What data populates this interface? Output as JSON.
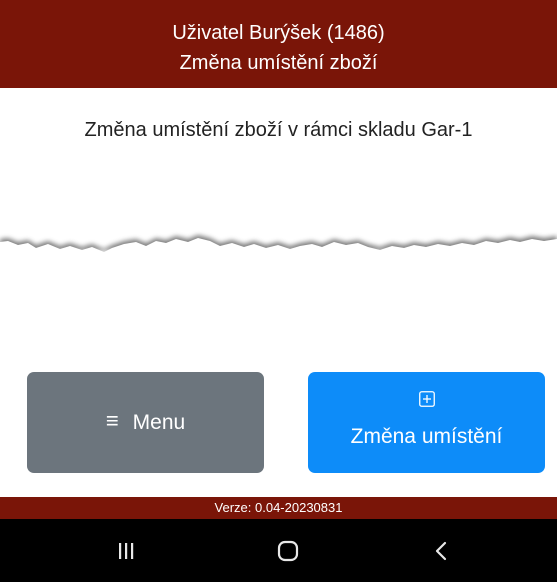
{
  "header": {
    "user": "Uživatel Burýšek (1486)",
    "title": "Změna umístění zboží",
    "background": "#7a1508"
  },
  "main": {
    "description": "Změna umístění zboží v rámci skladu Gar-1"
  },
  "buttons": {
    "menu": {
      "icon": "hamburger-menu-icon",
      "label": "Menu",
      "color": "#6c757d"
    },
    "change_location": {
      "icon": "plus-square-icon",
      "label": "Změna umístění",
      "color": "#0d8cf9"
    }
  },
  "footer": {
    "version": "Verze: 0.04-20230831"
  },
  "system_nav": {
    "recents_icon": "recent-apps-icon",
    "home_icon": "home-icon",
    "back_icon": "back-icon"
  }
}
